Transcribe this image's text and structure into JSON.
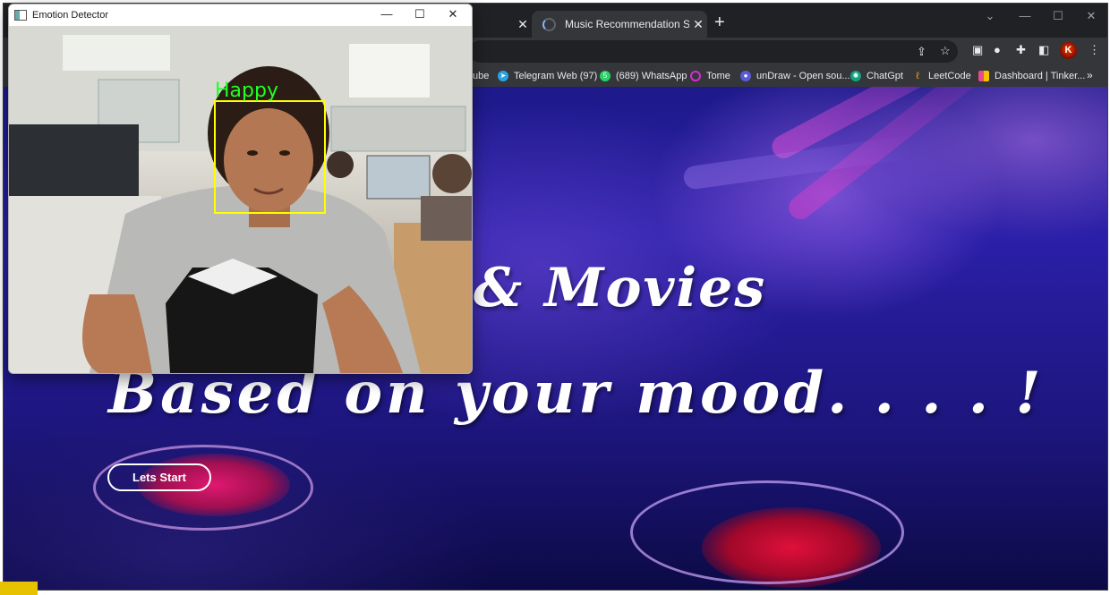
{
  "browser": {
    "tabs": [
      {
        "title": "",
        "active": false
      },
      {
        "title": "Music Recommendation System",
        "active": true
      }
    ],
    "new_tab_label": "+",
    "bookmarks": [
      {
        "label": "ube",
        "icon": "youtube-icon",
        "color": "#ff0000"
      },
      {
        "label": "Telegram Web (97)",
        "icon": "telegram-icon",
        "color": "#2aa3e0"
      },
      {
        "label": "(689) WhatsApp",
        "icon": "whatsapp-icon",
        "color": "#25d366"
      },
      {
        "label": "Tome",
        "icon": "tome-icon",
        "color": "#d62ad6"
      },
      {
        "label": "unDraw - Open sou...",
        "icon": "undraw-icon",
        "color": "#5b5bd6"
      },
      {
        "label": "ChatGpt",
        "icon": "chatgpt-icon",
        "color": "#10a37f"
      },
      {
        "label": "LeetCode",
        "icon": "leetcode-icon",
        "color": "#f0a020"
      },
      {
        "label": "Dashboard | Tinker...",
        "icon": "tinkercad-icon",
        "color": "#e84b8a"
      }
    ],
    "bookmarks_more": "»",
    "profile_initial": "K"
  },
  "page": {
    "hero_line_1": "& Movies",
    "hero_line_2": "Based on your mood. . . . !",
    "start_button": "Lets Start"
  },
  "detector": {
    "title": "Emotion Detector",
    "emotion_label": "Happy",
    "box_color": "#ffff00",
    "label_color": "#22ff22"
  },
  "colors": {
    "page_bg": "#1d1a8a",
    "chrome_dark": "#202124",
    "chrome_mid": "#35363a"
  }
}
